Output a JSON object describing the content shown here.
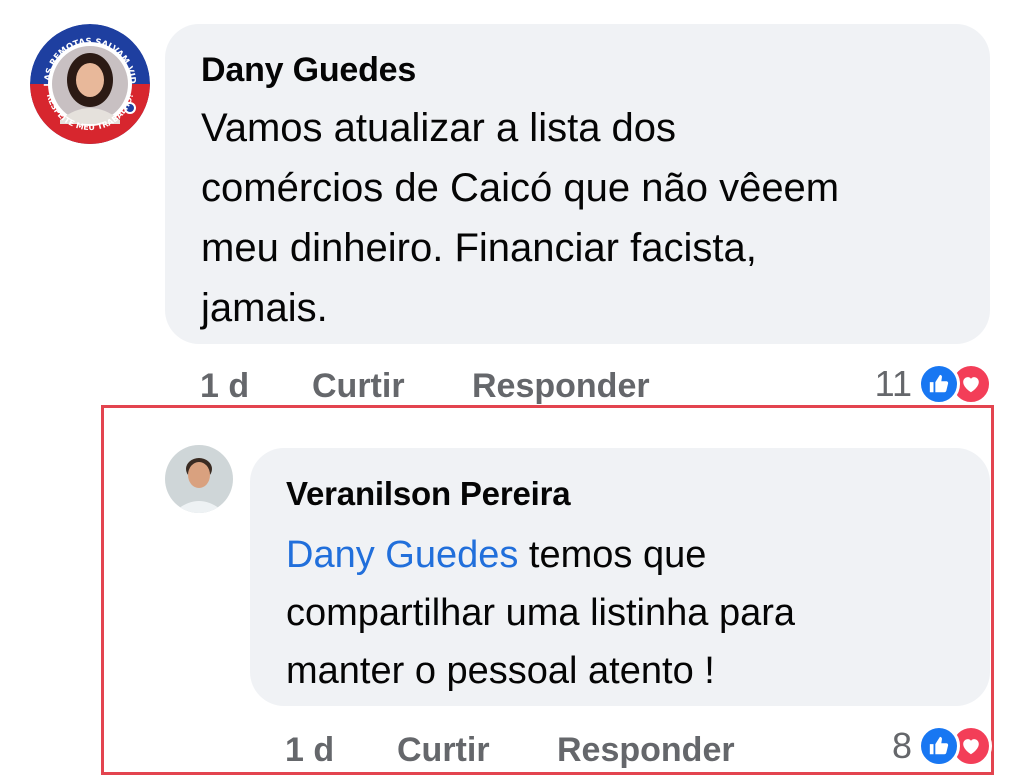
{
  "colors": {
    "bubble_bg": "#f0f2f5",
    "mention": "#216fdb",
    "meta_text": "#65676b",
    "like": "#1877f2",
    "love": "#f33e58",
    "highlight_border": "#e3444f"
  },
  "comment": {
    "avatar_badge_top": "AULAS REMOTAS SALVAM VIDAS.",
    "avatar_badge_bottom": "RESPEITE MEU TRABALHO!",
    "author": "Dany Guedes",
    "lines": [
      "Vamos atualizar a lista dos",
      "comércios de Caicó que não vêeem",
      "meu dinheiro. Financiar facista,",
      "jamais."
    ],
    "time": "1 d",
    "like_label": "Curtir",
    "reply_label": "Responder",
    "reaction_count": "11",
    "reaction_icons": [
      "like-icon",
      "love-icon"
    ]
  },
  "reply": {
    "author": "Veranilson Pereira",
    "mention": "Dany Guedes",
    "line1_rest": " temos que",
    "lines": [
      "compartilhar uma listinha para",
      "manter o pessoal atento !"
    ],
    "time": "1 d",
    "like_label": "Curtir",
    "reply_label": "Responder",
    "reaction_count": "8",
    "reaction_icons": [
      "like-icon",
      "love-icon"
    ]
  }
}
